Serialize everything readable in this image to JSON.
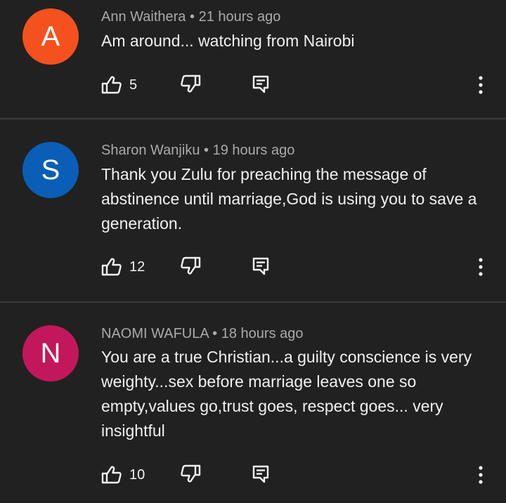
{
  "comments": [
    {
      "avatar_letter": "A",
      "avatar_color": "#f4511e",
      "author": "Ann Waithera",
      "separator": "•",
      "time": "21 hours ago",
      "text": "Am around... watching from Nairobi",
      "likes": "5"
    },
    {
      "avatar_letter": "S",
      "avatar_color": "#0b5eb5",
      "author": "Sharon Wanjiku",
      "separator": "•",
      "time": "19 hours ago",
      "text": "Thank you Zulu for preaching the message of abstinence until marriage,God is using you to save a generation.",
      "likes": "12"
    },
    {
      "avatar_letter": "N",
      "avatar_color": "#c2185b",
      "author": "NAOMI WAFULA",
      "separator": "•",
      "time": "18 hours ago",
      "text": "You are a true Christian...a guilty conscience is very weighty...sex before marriage leaves one so empty,values go,trust goes, respect goes... very insightful",
      "likes": "10"
    }
  ],
  "icons": {
    "like": "thumbs-up-icon",
    "dislike": "thumbs-down-icon",
    "reply": "reply-icon",
    "more": "more-vert-icon"
  },
  "colors": {
    "background": "#212121",
    "text_primary": "#f1f1f1",
    "text_secondary": "#aaaaaa",
    "divider": "#3a3a3a"
  }
}
